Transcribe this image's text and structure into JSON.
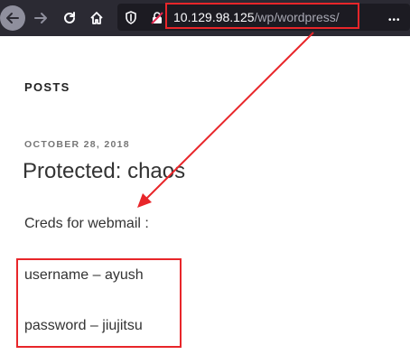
{
  "browser": {
    "url_host": "10.129.98.125",
    "url_path": "/wp/wordpress/",
    "more_icon": "•••"
  },
  "page": {
    "posts_heading": "POSTS",
    "post": {
      "date": "OCTOBER 28, 2018",
      "title": "Protected: chaos",
      "lines": [
        "Creds for webmail :",
        "username – ayush",
        "password – jiujitsu"
      ]
    }
  },
  "annotations": {
    "highlight_color": "#e8262a"
  },
  "icons": [
    "back-arrow-icon",
    "forward-arrow-icon",
    "reload-icon",
    "home-icon",
    "shield-icon",
    "insecure-lock-icon",
    "more-icon"
  ]
}
